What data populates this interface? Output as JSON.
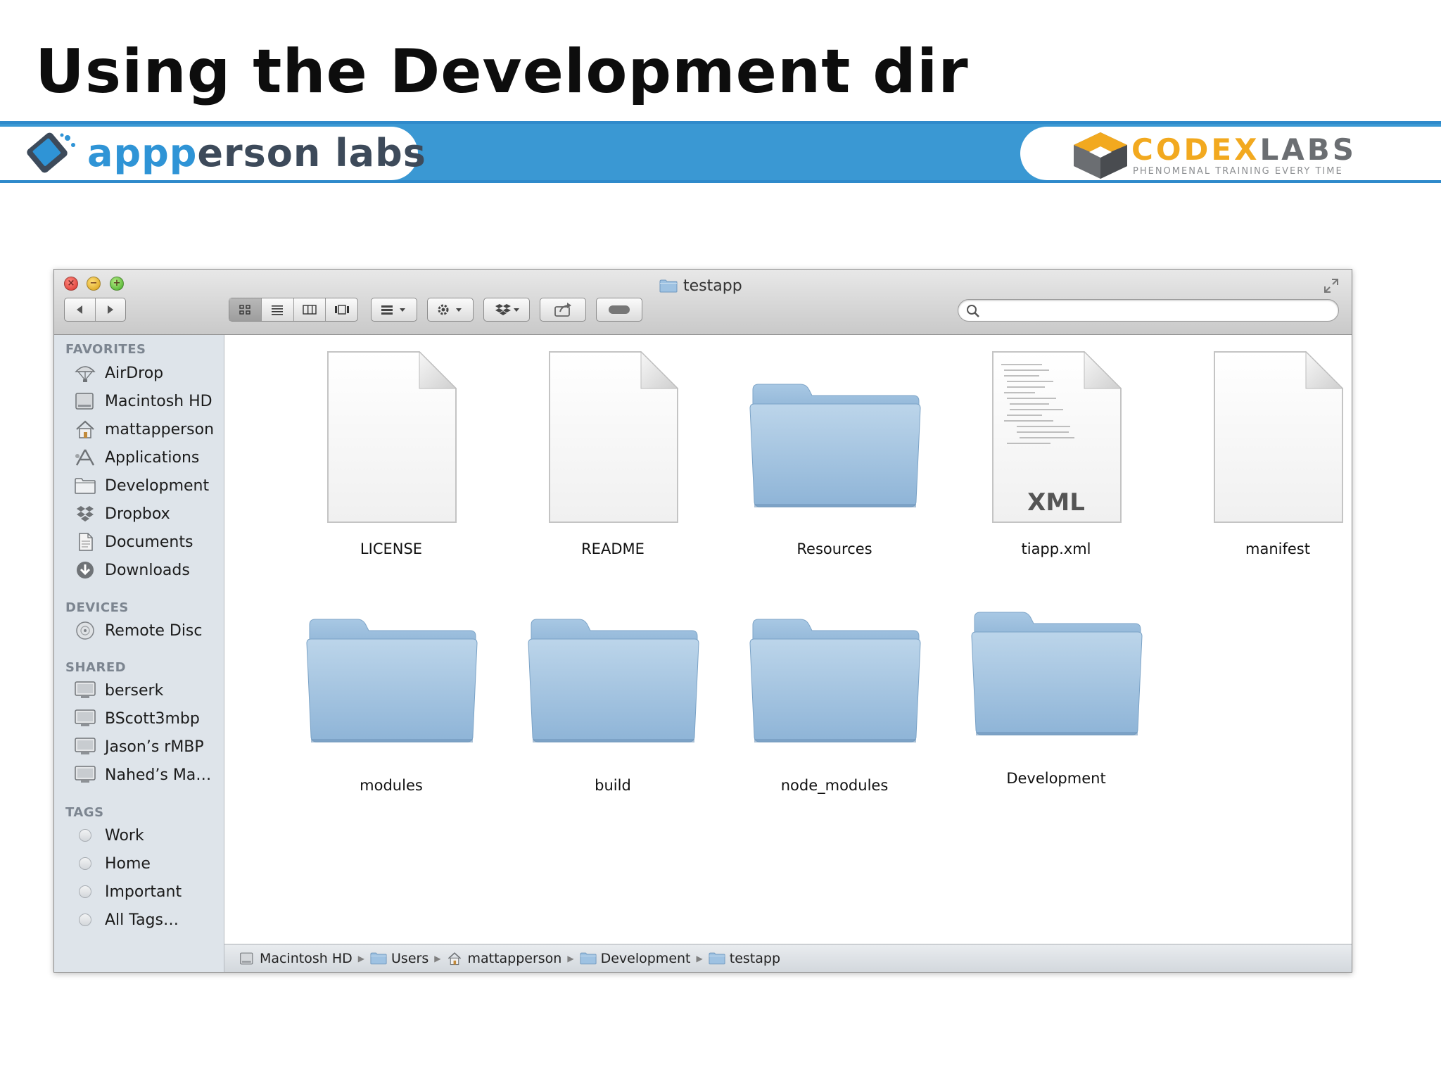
{
  "slide": {
    "title": "Using the Development dir"
  },
  "banner": {
    "left_brand_prefix": "app",
    "left_brand_rest": "erson labs",
    "left_brand_accent": "p",
    "right_brand_gold": "CODEX",
    "right_brand_gray": "LABS",
    "right_tagline": "PHENOMENAL TRAINING EVERY TIME",
    "colors": {
      "banner": "#3a98d3",
      "gold": "#f2a91f",
      "gray": "#6b6e72"
    }
  },
  "window": {
    "title": "testapp",
    "search": {
      "value": "",
      "placeholder": ""
    },
    "toolbar": {
      "back_icon": "chevron-left-icon",
      "forward_icon": "chevron-right-icon",
      "view_modes": [
        "icon-view",
        "list-view",
        "column-view",
        "coverflow-view"
      ],
      "selected_view": "icon-view"
    }
  },
  "sidebar": {
    "sections": {
      "favorites": "FAVORITES",
      "devices": "DEVICES",
      "shared": "SHARED",
      "tags": "TAGS"
    },
    "favorites": [
      {
        "label": "AirDrop",
        "icon": "airdrop-icon"
      },
      {
        "label": "Macintosh HD",
        "icon": "hard-drive-icon"
      },
      {
        "label": "mattapperson",
        "icon": "home-icon"
      },
      {
        "label": "Applications",
        "icon": "applications-icon"
      },
      {
        "label": "Development",
        "icon": "folder-icon"
      },
      {
        "label": "Dropbox",
        "icon": "dropbox-icon"
      },
      {
        "label": "Documents",
        "icon": "documents-icon"
      },
      {
        "label": "Downloads",
        "icon": "downloads-icon"
      }
    ],
    "devices": [
      {
        "label": "Remote Disc",
        "icon": "disc-icon"
      }
    ],
    "shared": [
      {
        "label": "berserk",
        "icon": "computer-icon"
      },
      {
        "label": "BScott3mbp",
        "icon": "computer-icon"
      },
      {
        "label": "Jason’s rMBP",
        "icon": "computer-icon"
      },
      {
        "label": "Nahed’s Ma…",
        "icon": "computer-icon"
      }
    ],
    "tags": [
      {
        "label": "Work"
      },
      {
        "label": "Home"
      },
      {
        "label": "Important"
      },
      {
        "label": "All Tags…"
      }
    ]
  },
  "files": [
    {
      "name": "LICENSE",
      "kind": "document"
    },
    {
      "name": "README",
      "kind": "document"
    },
    {
      "name": "Resources",
      "kind": "folder"
    },
    {
      "name": "tiapp.xml",
      "kind": "xml",
      "badge": "XML"
    },
    {
      "name": "manifest",
      "kind": "document"
    },
    {
      "name": "modules",
      "kind": "folder"
    },
    {
      "name": "build",
      "kind": "folder"
    },
    {
      "name": "node_modules",
      "kind": "folder"
    },
    {
      "name": "Development",
      "kind": "folder"
    }
  ],
  "pathbar": [
    {
      "label": "Macintosh HD",
      "icon": "hard-drive-icon"
    },
    {
      "label": "Users",
      "icon": "folder-icon"
    },
    {
      "label": "mattapperson",
      "icon": "home-icon"
    },
    {
      "label": "Development",
      "icon": "folder-icon"
    },
    {
      "label": "testapp",
      "icon": "folder-icon"
    }
  ]
}
